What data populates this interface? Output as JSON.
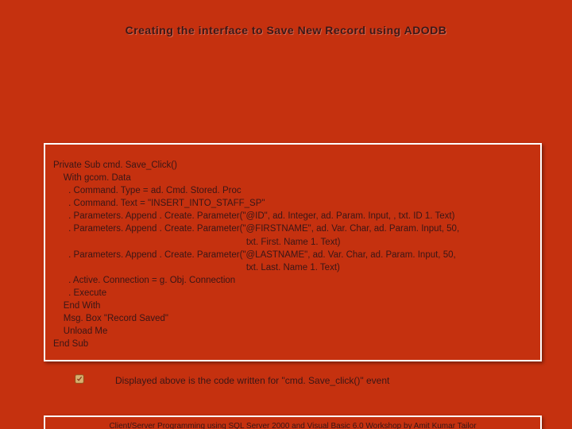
{
  "title": "Creating the interface to Save New Record using ADODB",
  "code": "Private Sub cmd. Save_Click()\n    With gcom. Data\n      . Command. Type = ad. Cmd. Stored. Proc\n      . Command. Text = \"INSERT_INTO_STAFF_SP\"\n      . Parameters. Append . Create. Parameter(\"@ID\", ad. Integer, ad. Param. Input, , txt. ID 1. Text)\n      . Parameters. Append . Create. Parameter(\"@FIRSTNAME\", ad. Var. Char, ad. Param. Input, 50,\n                                                                            txt. First. Name 1. Text)\n      . Parameters. Append . Create. Parameter(\"@LASTNAME\", ad. Var. Char, ad. Param. Input, 50,\n                                                                            txt. Last. Name 1. Text)\n      . Active. Connection = g. Obj. Connection\n      . Execute\n    End With\n    Msg. Box \"Record Saved\"\n    Unload Me\nEnd Sub",
  "caption": "Displayed above is the code written for \"cmd. Save_click()\" event",
  "footer": "Client/Server Programming using SQL Server 2000 and Visual Basic 6.0 Workshop by Amit Kumar Tailor"
}
